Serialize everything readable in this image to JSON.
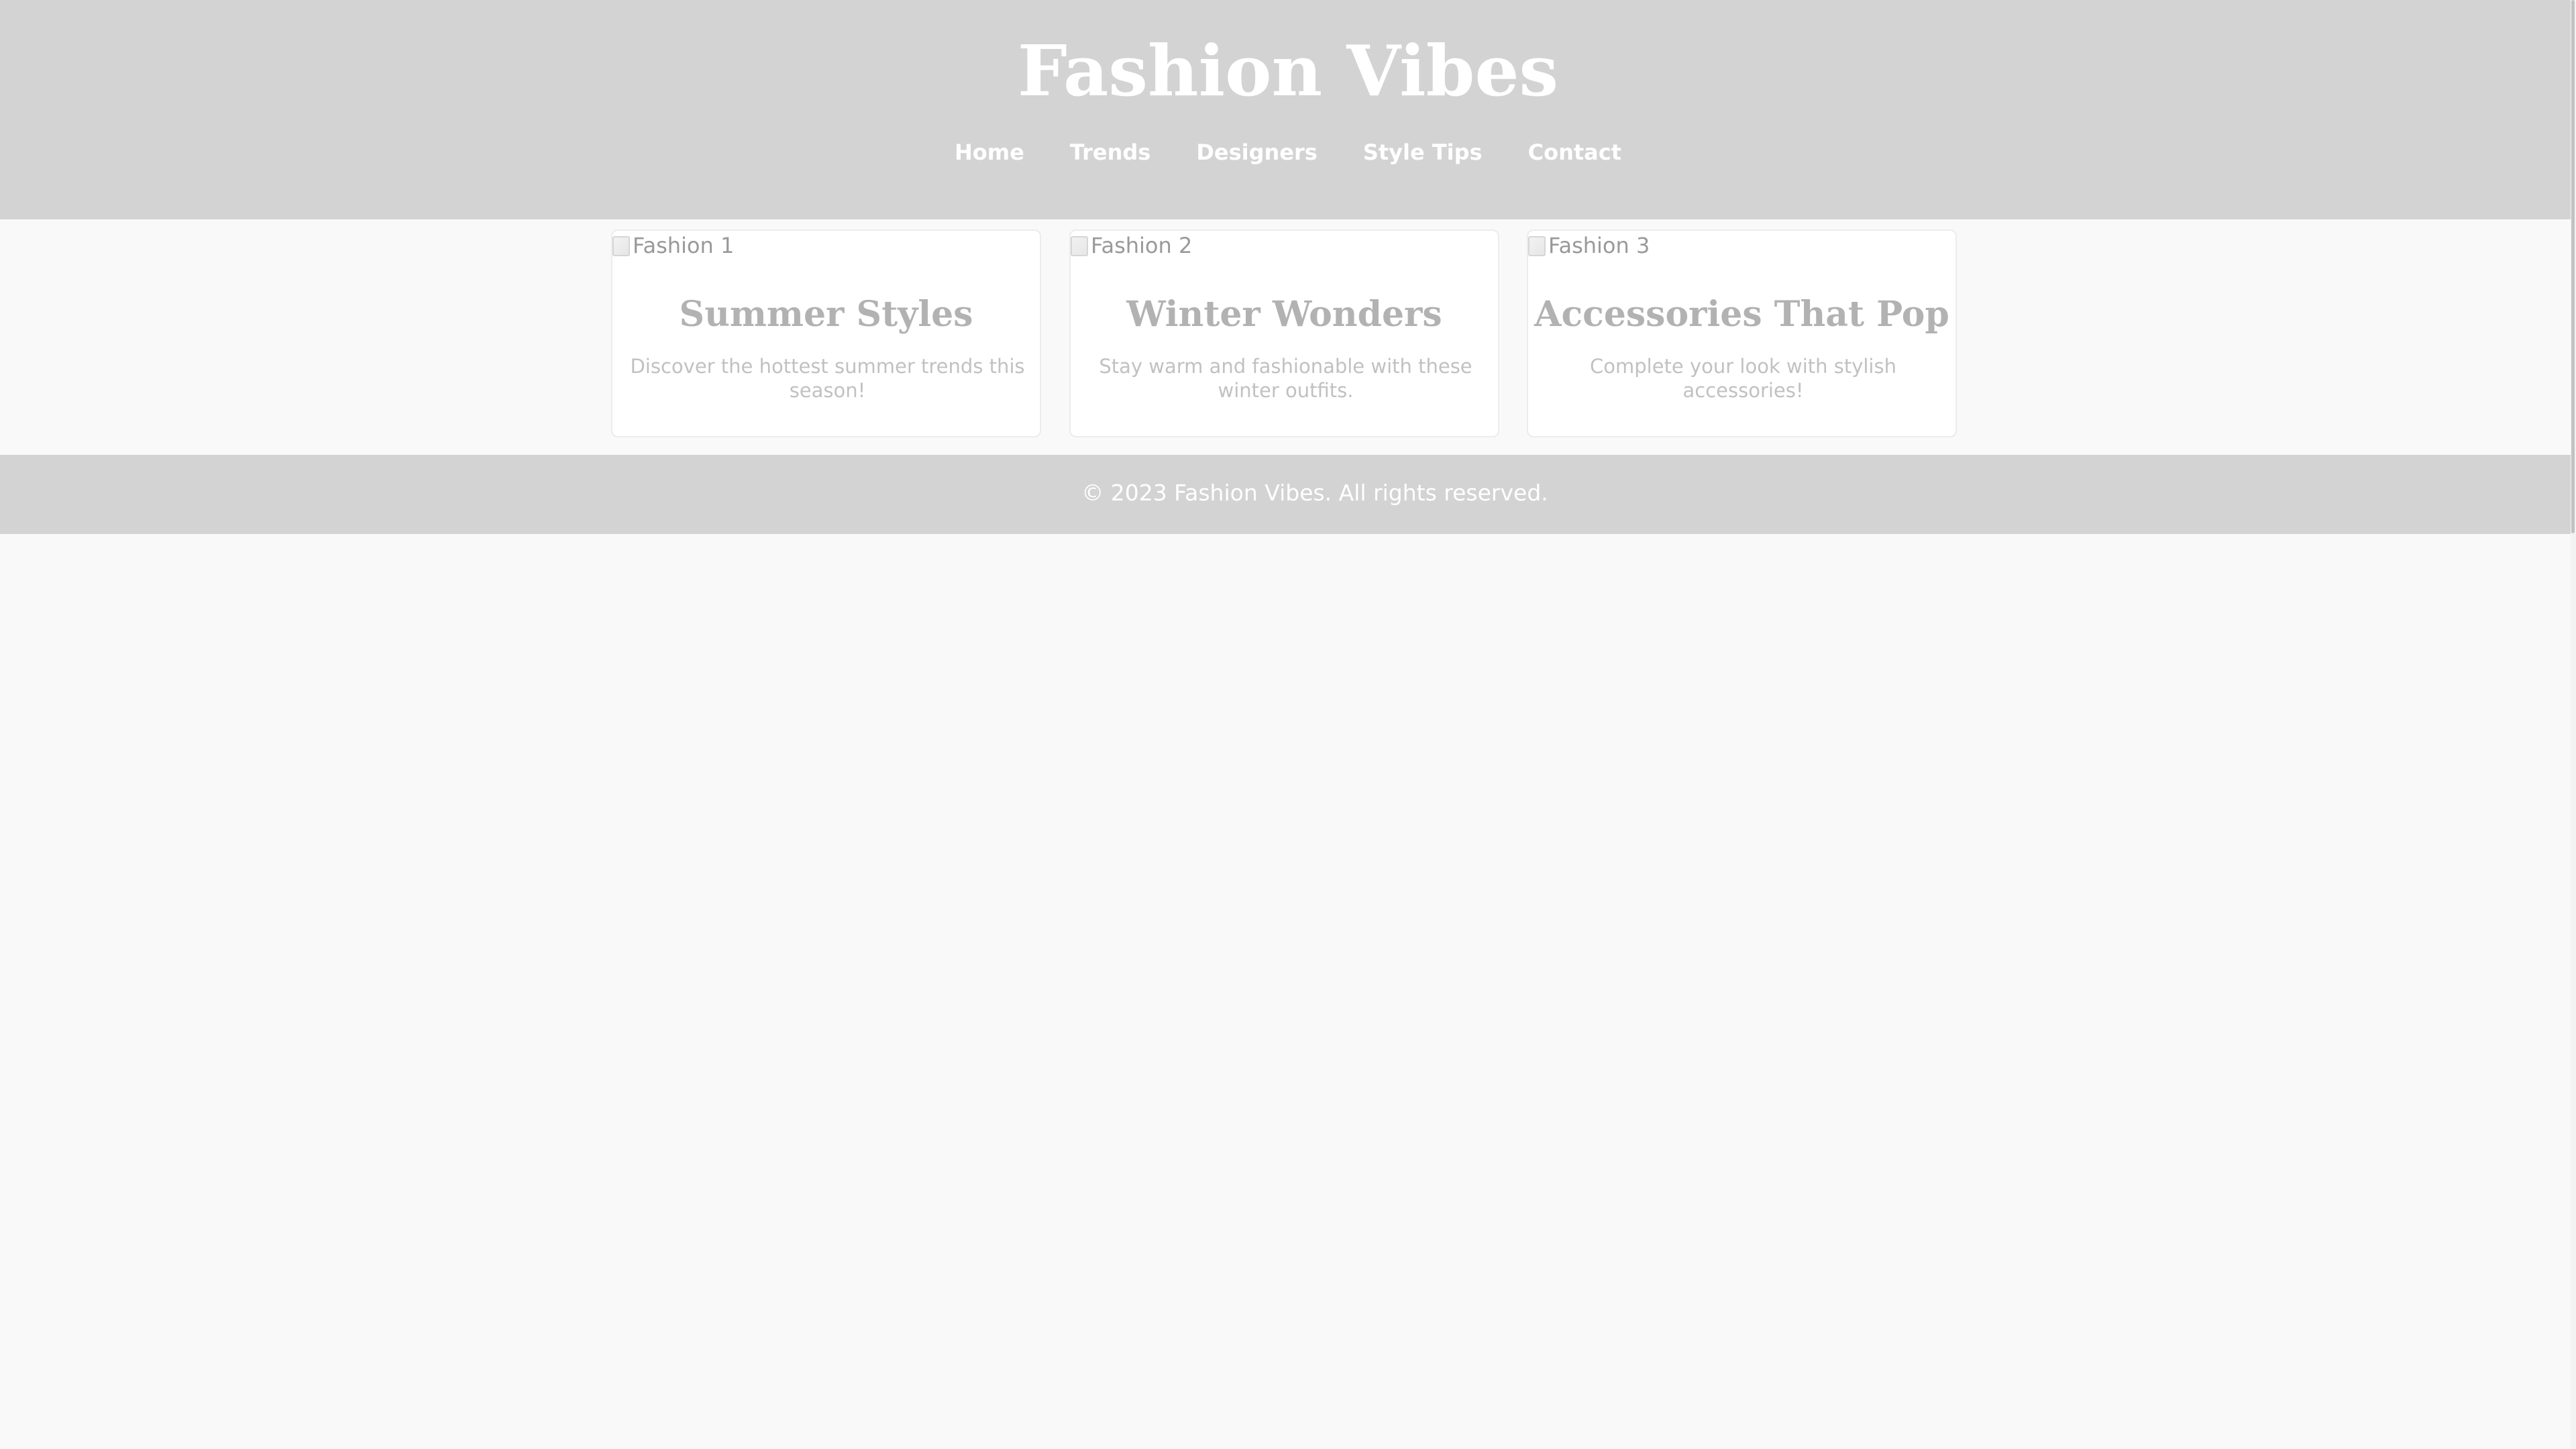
{
  "site": {
    "title": "Fashion Vibes"
  },
  "nav": {
    "items": [
      {
        "label": "Home"
      },
      {
        "label": "Trends"
      },
      {
        "label": "Designers"
      },
      {
        "label": "Style Tips"
      },
      {
        "label": "Contact"
      }
    ]
  },
  "cards": [
    {
      "image_alt": "Fashion 1",
      "image_icon": "broken-image-icon",
      "title": "Summer Styles",
      "text": "Discover the hottest summer trends this season!"
    },
    {
      "image_alt": "Fashion 2",
      "image_icon": "broken-image-icon",
      "title": "Winter Wonders",
      "text": "Stay warm and fashionable with these winter outfits."
    },
    {
      "image_alt": "Fashion 3",
      "image_icon": "broken-image-icon",
      "title": "Accessories That Pop",
      "text": "Complete your look with stylish accessories!"
    }
  ],
  "footer": {
    "text": "© 2023 Fashion Vibes. All rights reserved."
  },
  "colors": {
    "header_bg": "#d3d3d3",
    "page_bg": "#f9f9f9",
    "header_text": "#ffffff",
    "card_title": "#b2b2b2",
    "card_text": "#c1c1c1"
  }
}
